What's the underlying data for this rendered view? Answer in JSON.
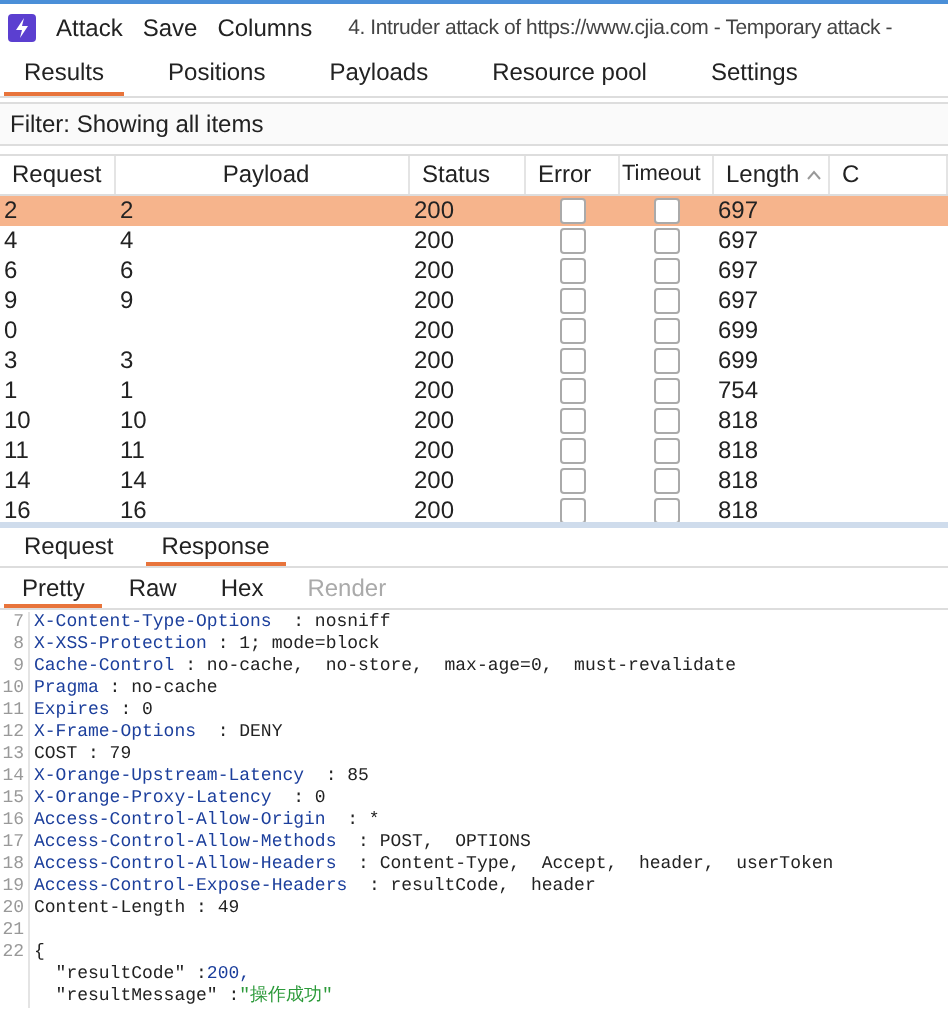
{
  "menu": [
    "Attack",
    "Save",
    "Columns"
  ],
  "window": {
    "title": "4. Intruder attack of https://www.cjia.com - Temporary attack -"
  },
  "tabs": [
    {
      "label": "Results",
      "selected": true
    },
    {
      "label": "Positions",
      "selected": false
    },
    {
      "label": "Payloads",
      "selected": false
    },
    {
      "label": "Resource pool",
      "selected": false
    },
    {
      "label": "Settings",
      "selected": false
    }
  ],
  "filter": "Filter: Showing all items",
  "table": {
    "columns": [
      {
        "label": "Request"
      },
      {
        "label": "Payload"
      },
      {
        "label": "Status"
      },
      {
        "label": "Error"
      },
      {
        "label": "Timeout"
      },
      {
        "label": "Length",
        "sorted": true
      },
      {
        "label": "C"
      }
    ],
    "rows": [
      {
        "request": "2",
        "payload": "2",
        "status": "200",
        "error": false,
        "timeout": false,
        "length": "697",
        "selected": true
      },
      {
        "request": "4",
        "payload": "4",
        "status": "200",
        "error": false,
        "timeout": false,
        "length": "697",
        "selected": false
      },
      {
        "request": "6",
        "payload": "6",
        "status": "200",
        "error": false,
        "timeout": false,
        "length": "697",
        "selected": false
      },
      {
        "request": "9",
        "payload": "9",
        "status": "200",
        "error": false,
        "timeout": false,
        "length": "697",
        "selected": false
      },
      {
        "request": "0",
        "status": "200",
        "error": false,
        "timeout": false,
        "length": "699",
        "selected": false
      },
      {
        "request": "3",
        "payload": "3",
        "status": "200",
        "error": false,
        "timeout": false,
        "length": "699",
        "selected": false
      },
      {
        "request": "1",
        "payload": "1",
        "status": "200",
        "error": false,
        "timeout": false,
        "length": "754",
        "selected": false
      },
      {
        "request": "10",
        "payload": "10",
        "status": "200",
        "error": false,
        "timeout": false,
        "length": "818",
        "selected": false
      },
      {
        "request": "11",
        "payload": "11",
        "status": "200",
        "error": false,
        "timeout": false,
        "length": "818",
        "selected": false
      },
      {
        "request": "14",
        "payload": "14",
        "status": "200",
        "error": false,
        "timeout": false,
        "length": "818",
        "selected": false
      },
      {
        "request": "16",
        "payload": "16",
        "status": "200",
        "error": false,
        "timeout": false,
        "length": "818",
        "selected": false
      }
    ]
  },
  "message_tabs": [
    {
      "label": "Request",
      "selected": false
    },
    {
      "label": "Response",
      "selected": true
    }
  ],
  "view_tabs": [
    {
      "label": "Pretty",
      "selected": true,
      "disabled": false
    },
    {
      "label": "Raw",
      "selected": false,
      "disabled": false
    },
    {
      "label": "Hex",
      "selected": false,
      "disabled": false
    },
    {
      "label": "Render",
      "selected": false,
      "disabled": true
    }
  ],
  "code": [
    {
      "kind": "header",
      "number": "7",
      "name": "X-Content-Type-Options",
      "value": "  : nosniff"
    },
    {
      "kind": "header",
      "number": "8",
      "name": "X-XSS-Protection",
      "value": " : 1; mode=block"
    },
    {
      "kind": "header",
      "number": "9",
      "name": "Cache-Control",
      "value": " : no-cache,  no-store,  max-age=0,  must-revalidate"
    },
    {
      "kind": "header",
      "number": "10",
      "name": "Pragma",
      "value": " : no-cache"
    },
    {
      "kind": "header",
      "number": "11",
      "name": "Expires",
      "value": " : 0"
    },
    {
      "kind": "header",
      "number": "12",
      "name": "X-Frame-Options",
      "value": "  : DENY"
    },
    {
      "kind": "plain",
      "number": "13",
      "text": "COST : 79"
    },
    {
      "kind": "header",
      "number": "14",
      "name": "X-Orange-Upstream-Latency",
      "value": "  : 85"
    },
    {
      "kind": "header",
      "number": "15",
      "name": "X-Orange-Proxy-Latency",
      "value": "  : 0"
    },
    {
      "kind": "header",
      "number": "16",
      "name": "Access-Control-Allow-Origin",
      "value": "  : *"
    },
    {
      "kind": "header",
      "number": "17",
      "name": "Access-Control-Allow-Methods",
      "value": "  : POST,  OPTIONS"
    },
    {
      "kind": "header",
      "number": "18",
      "name": "Access-Control-Allow-Headers",
      "value": "  : Content-Type,  Accept,  header,  userToken"
    },
    {
      "kind": "header",
      "number": "19",
      "name": "Access-Control-Expose-Headers",
      "value": "  : resultCode,  header"
    },
    {
      "kind": "plain",
      "number": "20",
      "text": "Content-Length : 49"
    },
    {
      "kind": "blank",
      "number": "21"
    },
    {
      "kind": "plain",
      "number": "22",
      "text": "{"
    },
    {
      "kind": "json-number",
      "key": "  \"resultCode\" :",
      "value": "200,"
    },
    {
      "kind": "json-string",
      "key": "  \"resultMessage\" :",
      "value": "\"操作成功\""
    }
  ]
}
